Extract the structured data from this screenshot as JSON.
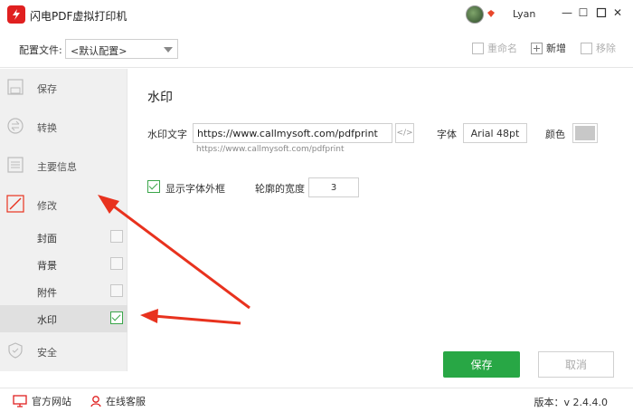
{
  "titlebar": {
    "app_title": "闪电PDF虚拟打印机",
    "username": "Lyan",
    "minimize": "—",
    "maximize": "☐",
    "close": "✕"
  },
  "configbar": {
    "label": "配置文件:",
    "selected": "<默认配置>",
    "rename": "重命名",
    "add": "新增",
    "remove": "移除"
  },
  "sidebar": {
    "items": [
      {
        "label": "保存",
        "icon": "save-icon"
      },
      {
        "label": "转换",
        "icon": "convert-icon"
      },
      {
        "label": "主要信息",
        "icon": "info-icon"
      },
      {
        "label": "修改",
        "icon": "edit-icon"
      },
      {
        "label": "安全",
        "icon": "shield-icon"
      }
    ],
    "sub_items": [
      {
        "label": "封面",
        "checked": false
      },
      {
        "label": "背景",
        "checked": false
      },
      {
        "label": "附件",
        "checked": false
      },
      {
        "label": "水印",
        "checked": true
      }
    ]
  },
  "main": {
    "title": "水印",
    "watermark_text_label": "水印文字",
    "watermark_text_value": "https://www.callmysoft.com/pdfprint",
    "code_button": "</>",
    "preview_hint": "https://www.callmysoft.com/pdfprint",
    "font_label": "字体",
    "font_value": "Arial 48pt",
    "color_label": "颜色",
    "color_value": "#c8c8c8",
    "show_outline_label": "显示字体外框",
    "outline_width_label": "轮廓的宽度",
    "outline_width_value": "3",
    "save_button": "保存",
    "cancel_button": "取消"
  },
  "footer": {
    "website": "官方网站",
    "support": "在线客服",
    "version": "版本：v 2.4.4.0"
  },
  "colors": {
    "accent_green": "#28a745",
    "brand_red": "#e02020",
    "annotation_red": "#e8321e"
  }
}
